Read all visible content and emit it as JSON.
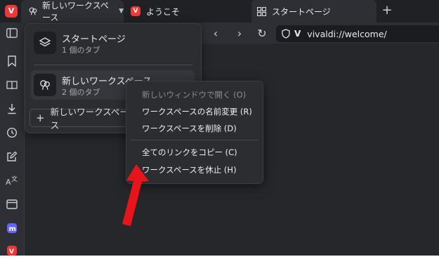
{
  "tabs": {
    "workspace_label": "新しいワークスペース",
    "welcome_label": "ようこそ",
    "start_label": "スタートページ",
    "new_tab": "+"
  },
  "toolbar": {
    "back": "‹",
    "forward": "›",
    "reload": "↻",
    "address_scheme": "V",
    "url": "vivaldi://welcome/"
  },
  "workspace_panel": {
    "items": [
      {
        "name": "スタートページ",
        "count": "1 個のタブ"
      },
      {
        "name": "新しいワークスペース",
        "count": "2 個のタブ"
      }
    ],
    "new_button": "新しいワークスペース"
  },
  "context_menu": {
    "items": [
      {
        "label": "新しいウィンドウで開く (O)",
        "disabled": true
      },
      {
        "label": "ワークスペースの名前変更 (R)",
        "disabled": false
      },
      {
        "label": "ワークスペースを削除 (D)",
        "disabled": false
      },
      {
        "label": "全てのリンクをコピー (C)",
        "disabled": false
      },
      {
        "label": "ワークスペースを休止 (H)",
        "disabled": false
      }
    ]
  },
  "colors": {
    "accent": "#ef3939",
    "mastodon": "#6364ff",
    "arrow": "#e8141c"
  },
  "icons": [
    "panel-toggle-icon",
    "bookmark-icon",
    "reading-list-icon",
    "download-icon",
    "history-icon",
    "notes-icon",
    "translate-icon",
    "window-icon",
    "mastodon-icon",
    "vivaldi-social-icon"
  ]
}
